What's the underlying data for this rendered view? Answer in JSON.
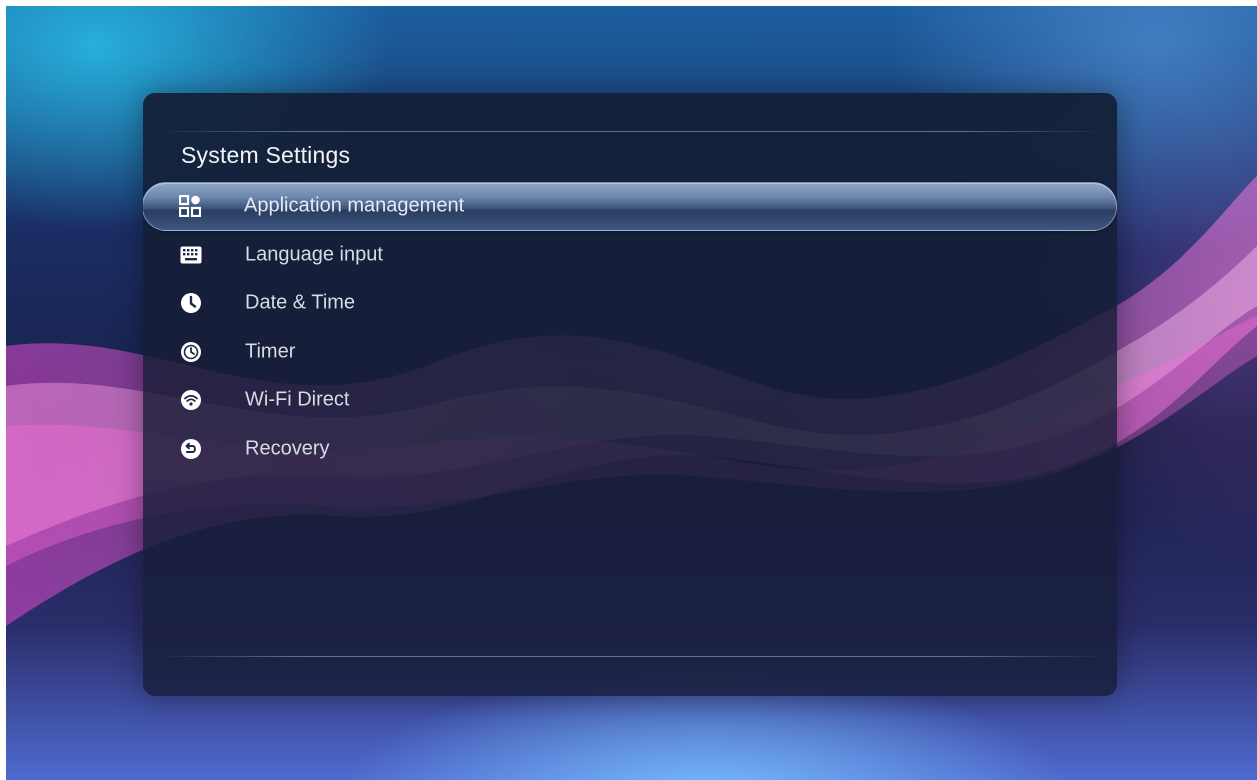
{
  "title": "System Settings",
  "menu": {
    "selected_index": 0,
    "items": [
      {
        "label": "Application management",
        "icon": "apps-grid-icon"
      },
      {
        "label": "Language input",
        "icon": "keyboard-icon"
      },
      {
        "label": "Date & Time",
        "icon": "clock-icon"
      },
      {
        "label": "Timer",
        "icon": "timer-icon"
      },
      {
        "label": "Wi-Fi Direct",
        "icon": "wifi-icon"
      },
      {
        "label": "Recovery",
        "icon": "recovery-icon"
      }
    ]
  },
  "colors": {
    "highlight": "#6d86ad",
    "title_text": "#f2f4f8",
    "item_text": "#d7dbe3"
  }
}
